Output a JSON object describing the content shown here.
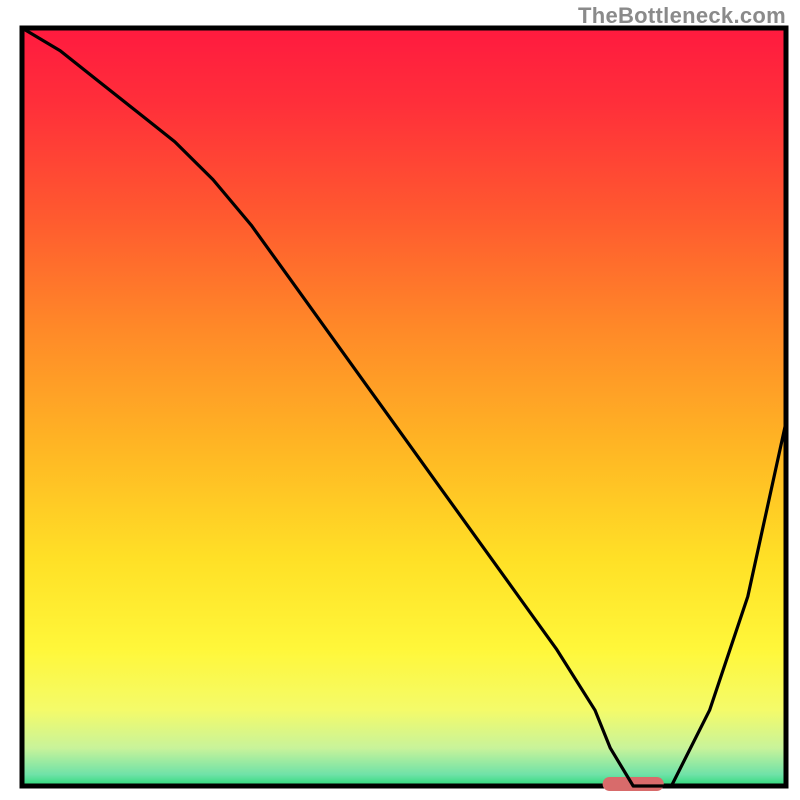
{
  "watermark": "TheBottleneck.com",
  "chart_data": {
    "type": "line",
    "title": "",
    "xlabel": "",
    "ylabel": "",
    "xlim": [
      0,
      100
    ],
    "ylim": [
      0,
      100
    ],
    "x": [
      0,
      5,
      10,
      15,
      20,
      25,
      30,
      35,
      40,
      45,
      50,
      55,
      60,
      65,
      70,
      75,
      77,
      80,
      85,
      90,
      95,
      100
    ],
    "values": [
      100,
      97,
      93,
      89,
      85,
      80,
      74,
      67,
      60,
      53,
      46,
      39,
      32,
      25,
      18,
      10,
      5,
      0,
      0,
      10,
      25,
      48
    ],
    "optimal_band": {
      "x_start": 76,
      "x_end": 84,
      "y": 0
    },
    "gradient_stops": [
      {
        "offset": 0.0,
        "color": "#ff1a3f"
      },
      {
        "offset": 0.1,
        "color": "#ff2f3a"
      },
      {
        "offset": 0.25,
        "color": "#ff5a2f"
      },
      {
        "offset": 0.4,
        "color": "#ff8a28"
      },
      {
        "offset": 0.55,
        "color": "#ffb524"
      },
      {
        "offset": 0.7,
        "color": "#ffe026"
      },
      {
        "offset": 0.82,
        "color": "#fff73a"
      },
      {
        "offset": 0.9,
        "color": "#f4fb6a"
      },
      {
        "offset": 0.95,
        "color": "#c8f39a"
      },
      {
        "offset": 0.985,
        "color": "#6fe2a8"
      },
      {
        "offset": 1.0,
        "color": "#2bd978"
      }
    ],
    "optimal_marker_color": "#d86b6b",
    "curve_color": "#000000",
    "frame_color": "#000000"
  }
}
